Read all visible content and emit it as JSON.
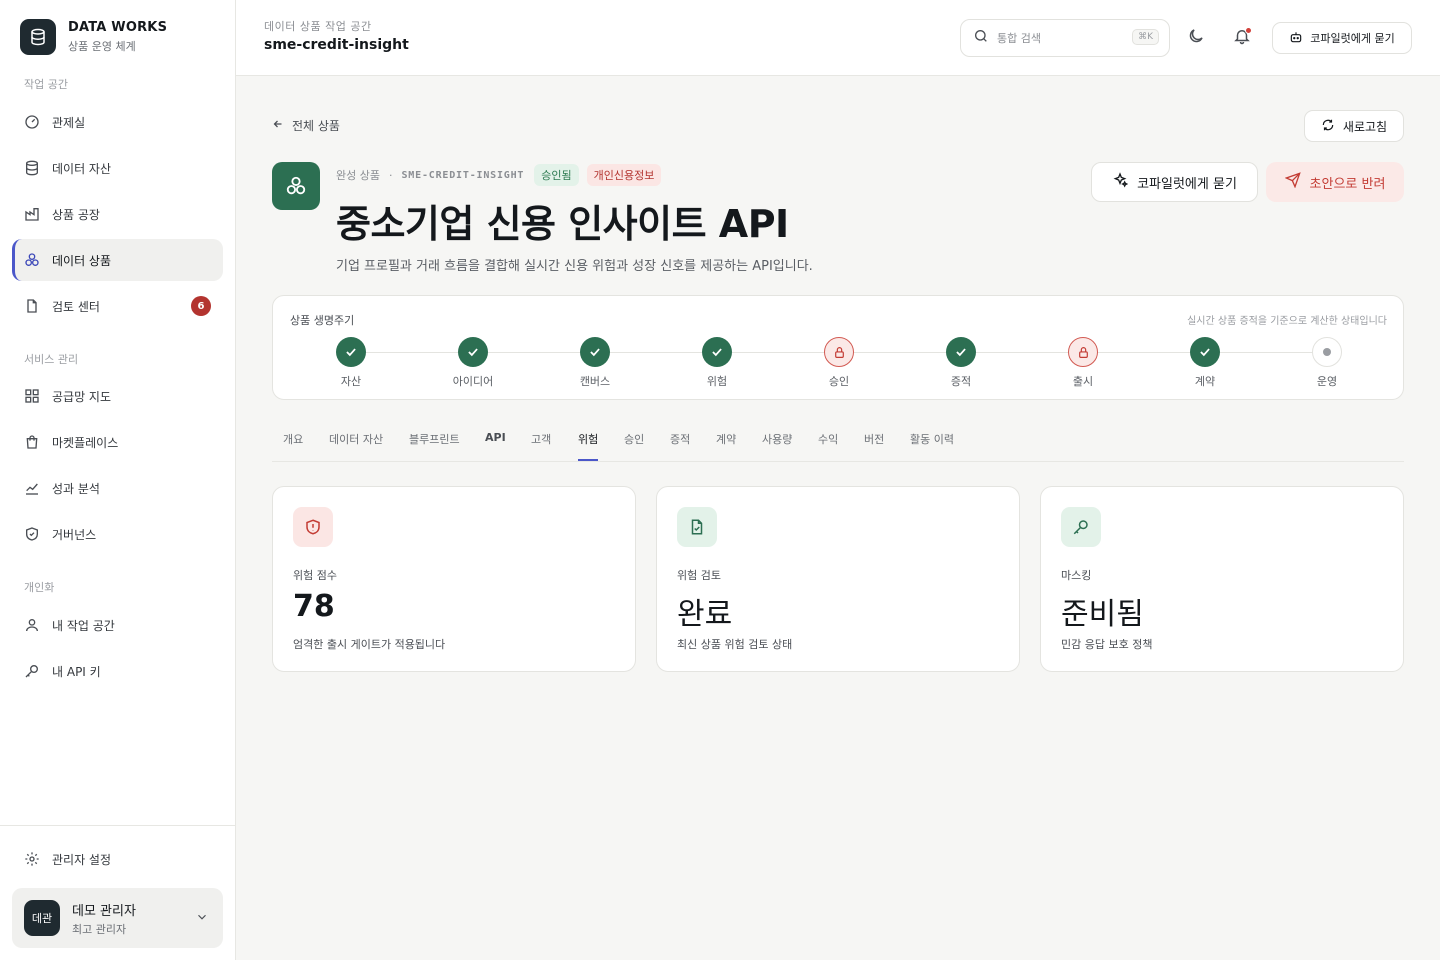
{
  "brand": {
    "title": "DATA WORKS",
    "subtitle": "상품 운영 체계"
  },
  "sidebar": {
    "sections": [
      "작업 공간",
      "서비스 관리",
      "개인화"
    ],
    "workspace_items": [
      {
        "label": "관제실",
        "icon": "gauge-icon"
      },
      {
        "label": "데이터 자산",
        "icon": "database-icon"
      },
      {
        "label": "상품 공장",
        "icon": "factory-icon"
      },
      {
        "label": "데이터 상품",
        "icon": "product-icon",
        "active": true
      },
      {
        "label": "검토 센터",
        "icon": "file-review-icon",
        "badge": "6"
      }
    ],
    "service_items": [
      {
        "label": "공급망 지도",
        "icon": "network-icon"
      },
      {
        "label": "마켓플레이스",
        "icon": "shopping-bag-icon"
      },
      {
        "label": "성과 분석",
        "icon": "chart-icon"
      },
      {
        "label": "거버넌스",
        "icon": "shield-check-icon"
      }
    ],
    "personal_items": [
      {
        "label": "내 작업 공간",
        "icon": "user-icon"
      },
      {
        "label": "내 API 키",
        "icon": "key-icon"
      }
    ],
    "admin_settings": "관리자 설정",
    "user": {
      "avatar": "데관",
      "name": "데모 관리자",
      "role": "최고 관리자"
    }
  },
  "topbar": {
    "workspace_label": "데이터 상품 작업 공간",
    "workspace_name": "sme-credit-insight",
    "search_placeholder": "통합 검색",
    "search_shortcut": "⌘K",
    "ask_copilot": "코파일럿에게 묻기"
  },
  "page": {
    "back_label": "전체 상품",
    "refresh_label": "새로고침",
    "crumb_stage": "완성 상품",
    "crumb_code": "SME-CREDIT-INSIGHT",
    "badge_status": "승인됨",
    "badge_class": "개인신용정보",
    "title_main": "중소기업 신용 인사이트 ",
    "title_bold": "API",
    "description": "기업 프로필과 거래 흐름을 결합해 실시간 신용 위험과 성장 신호를 제공하는 API입니다.",
    "ask_copilot": "코파일럿에게 묻기",
    "reject_label": "초안으로 반려"
  },
  "lifecycle": {
    "title": "상품 생명주기",
    "note": "실시간 상품 증적을 기준으로 계산한 상태입니다",
    "steps": [
      {
        "label": "자산",
        "state": "done"
      },
      {
        "label": "아이디어",
        "state": "done"
      },
      {
        "label": "캔버스",
        "state": "done"
      },
      {
        "label": "위험",
        "state": "done"
      },
      {
        "label": "승인",
        "state": "locked"
      },
      {
        "label": "증적",
        "state": "done"
      },
      {
        "label": "출시",
        "state": "locked"
      },
      {
        "label": "계약",
        "state": "done"
      },
      {
        "label": "운영",
        "state": "pending"
      }
    ]
  },
  "tabs": [
    "개요",
    "데이터 자산",
    "블루프린트",
    "API",
    "고객",
    "위험",
    "승인",
    "증적",
    "계약",
    "사용량",
    "수익",
    "버전",
    "활동 이력"
  ],
  "active_tab": "위험",
  "cards": [
    {
      "label": "위험 점수",
      "value": "78",
      "desc": "엄격한 출시 게이트가 적용됩니다",
      "icon": "shield-alert-icon"
    },
    {
      "label": "위험 검토",
      "value": "완료",
      "desc": "최신 상품 위험 검토 상태",
      "icon": "file-check-icon"
    },
    {
      "label": "마스킹",
      "value": "준비됨",
      "desc": "민감 응답 보호 정책",
      "icon": "key-icon"
    }
  ],
  "colors": {
    "accent": "#4b57c9",
    "brand_green": "#2c6f52",
    "danger": "#b3342f"
  }
}
